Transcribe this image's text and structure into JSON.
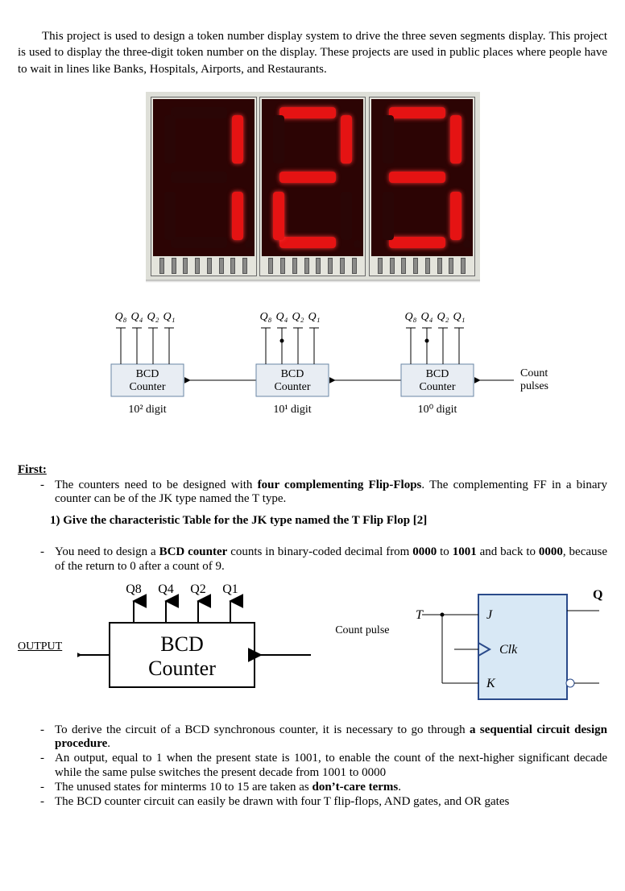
{
  "intro": "This project is used to design a token number display system to drive the three seven segments display. This project is used to display the three-digit token number on the display. These projects are used in public places where people have to wait in lines like Banks, Hospitals, Airports, and Restaurants.",
  "display": {
    "digits": [
      {
        "value": "1",
        "segments": [
          "b",
          "c"
        ]
      },
      {
        "value": "2",
        "segments": [
          "a",
          "b",
          "g",
          "e",
          "d"
        ]
      },
      {
        "value": "3",
        "segments": [
          "a",
          "b",
          "g",
          "c",
          "d"
        ]
      }
    ]
  },
  "cascade": {
    "q_labels": [
      "Q₈",
      "Q₄",
      "Q₂",
      "Q₁"
    ],
    "box_label_l1": "BCD",
    "box_label_l2": "Counter",
    "digit_labels": [
      "10² digit",
      "10¹ digit",
      "10⁰ digit"
    ],
    "count_pulses_l1": "Count",
    "count_pulses_l2": "pulses"
  },
  "first_head": "First:",
  "first_items": [
    {
      "pre": "The counters need to be designed with ",
      "bold": "four complementing Flip-Flops",
      "post": ". The complementing FF in a binary counter can be of the JK type named the T type."
    }
  ],
  "q1": "1)  Give the characteristic Table for the JK type named the T Flip Flop  [2]",
  "second_intro": {
    "pre": "You need to design a ",
    "bold1": "BCD counter",
    "mid": " counts in binary-coded decimal from ",
    "bold2": "0000",
    "mid2": " to ",
    "bold3": "1001",
    "mid3": " and back to ",
    "bold4": "0000",
    "post": ", because of the return to 0 after a count of 9."
  },
  "single": {
    "q_labels": [
      "Q8",
      "Q4",
      "Q2",
      "Q1"
    ],
    "box_l1": "BCD",
    "box_l2": "Counter",
    "count_pulse": "Count pulse",
    "output": "OUTPUT"
  },
  "jk": {
    "T": "T",
    "J": "J",
    "K": "K",
    "Clk": "Clk",
    "Q": "Q"
  },
  "final_items": [
    {
      "pre": "To derive the circuit of a BCD synchronous counter, it is necessary to go through ",
      "bold": "a sequential circuit design procedure",
      "post": "."
    },
    {
      "pre": "An output, equal to 1 when the present state is 1001, to enable the count of the next-higher significant decade while the same pulse switches the present decade from 1001 to 0000",
      "bold": "",
      "post": ""
    },
    {
      "pre": "The unused states for minterms 10 to 15 are taken as ",
      "bold": "don’t-care terms",
      "post": "."
    },
    {
      "pre": "The BCD counter circuit can easily be drawn with four T flip-flops, AND gates, and OR gates",
      "bold": "",
      "post": ""
    }
  ]
}
